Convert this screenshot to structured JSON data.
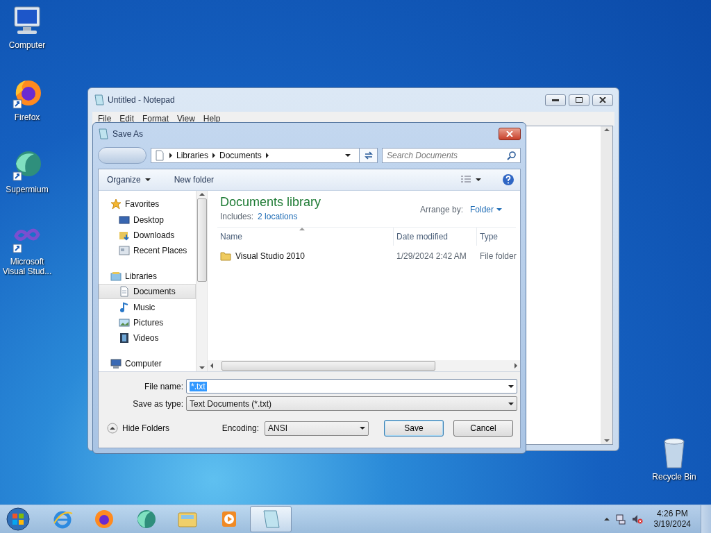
{
  "desktop_icons": [
    {
      "label": "Computer",
      "kind": "computer"
    },
    {
      "label": "Firefox",
      "kind": "firefox"
    },
    {
      "label": "Supermium",
      "kind": "supermium"
    },
    {
      "label": "Microsoft Visual Stud...",
      "kind": "vs"
    }
  ],
  "recycle_bin": {
    "label": "Recycle Bin"
  },
  "notepad": {
    "title": "Untitled - Notepad",
    "menu": [
      "File",
      "Edit",
      "Format",
      "View",
      "Help"
    ]
  },
  "dialog": {
    "title": "Save As",
    "breadcrumb": [
      "Libraries",
      "Documents"
    ],
    "search": {
      "placeholder": "Search Documents"
    },
    "toolbar": {
      "organize": "Organize",
      "new_folder": "New folder"
    },
    "nav": [
      {
        "label": "Favorites",
        "kind": "star",
        "selected": false,
        "children": [
          {
            "label": "Desktop",
            "kind": "desktop",
            "selected": false
          },
          {
            "label": "Downloads",
            "kind": "downloads",
            "selected": false
          },
          {
            "label": "Recent Places",
            "kind": "recent",
            "selected": false
          }
        ]
      },
      {
        "label": "Libraries",
        "kind": "libraries",
        "selected": false,
        "children": [
          {
            "label": "Documents",
            "kind": "document",
            "selected": true
          },
          {
            "label": "Music",
            "kind": "music",
            "selected": false
          },
          {
            "label": "Pictures",
            "kind": "pictures",
            "selected": false
          },
          {
            "label": "Videos",
            "kind": "videos",
            "selected": false
          }
        ]
      },
      {
        "label": "Computer",
        "kind": "computer",
        "selected": false
      }
    ],
    "library": {
      "title": "Documents library",
      "includes_label": "Includes:",
      "includes_link": "2 locations",
      "arrange_label": "Arrange by:",
      "arrange_value": "Folder"
    },
    "columns": [
      "Name",
      "Date modified",
      "Type"
    ],
    "rows": [
      {
        "name": "Visual Studio 2010",
        "date": "1/29/2024 2:42 AM",
        "type": "File folder"
      }
    ],
    "file_name": {
      "label": "File name:",
      "value": "*.txt"
    },
    "save_as_type": {
      "label": "Save as type:",
      "value": "Text Documents (*.txt)"
    },
    "hide_folders": "Hide Folders",
    "encoding": {
      "label": "Encoding:",
      "value": "ANSI"
    },
    "buttons": [
      {
        "label": "Save",
        "kind": "default"
      },
      {
        "label": "Cancel",
        "kind": "normal"
      }
    ]
  },
  "taskbar": {
    "apps": [
      {
        "kind": "ie",
        "selected": false
      },
      {
        "kind": "firefox",
        "selected": false
      },
      {
        "kind": "supermium",
        "selected": false
      },
      {
        "kind": "explorer",
        "selected": false
      },
      {
        "kind": "media",
        "selected": false
      },
      {
        "kind": "notepad",
        "selected": true
      }
    ],
    "clock": {
      "time": "4:26 PM",
      "date": "3/19/2024"
    }
  }
}
